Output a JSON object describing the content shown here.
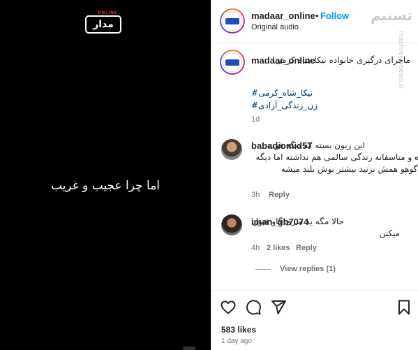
{
  "media": {
    "logo_text": "مدار",
    "logo_tag": "ONLINE",
    "overlay_text": "اما چرا عجیب و غریب"
  },
  "header": {
    "username": "madaar_online",
    "bullet": "•",
    "follow_label": "Follow",
    "subtitle": "Original audio"
  },
  "watermark": {
    "top": "تسنیم",
    "side": "mashreghnews.ir"
  },
  "caption": {
    "username": "madaar_online",
    "text": "ماجرای درگیری خانواده نیکا شاه کرمی!",
    "hashtags": [
      "#نیکا_شاه_کرمی",
      "#زن_زندگی_آزادی"
    ],
    "age": "1d"
  },
  "comments": [
    {
      "username": "babadiomid57",
      "text": "این زبون بسته که دیگه فوت کرده و متاسفانه زندگی سالمی هم نداشته اما دیگه این گوهو همش نزنید بیشتر بوش بلند میشه",
      "age": "3h",
      "likes": "",
      "reply_label": "Reply"
    },
    {
      "username": "iman_gh7074",
      "text": "حالا مگه یه سری گاو قبول میکنن",
      "age": "4h",
      "likes": "2 likes",
      "reply_label": "Reply"
    }
  ],
  "view_replies_label": "View replies (1)",
  "actions": {
    "icons": [
      "heart-icon",
      "comment-icon",
      "share-icon",
      "bookmark-icon"
    ],
    "likes": "583 likes",
    "time": "1 day ago"
  },
  "colors": {
    "accent": "#0095f6",
    "hashtag": "#00376b",
    "muted": "#737373"
  }
}
